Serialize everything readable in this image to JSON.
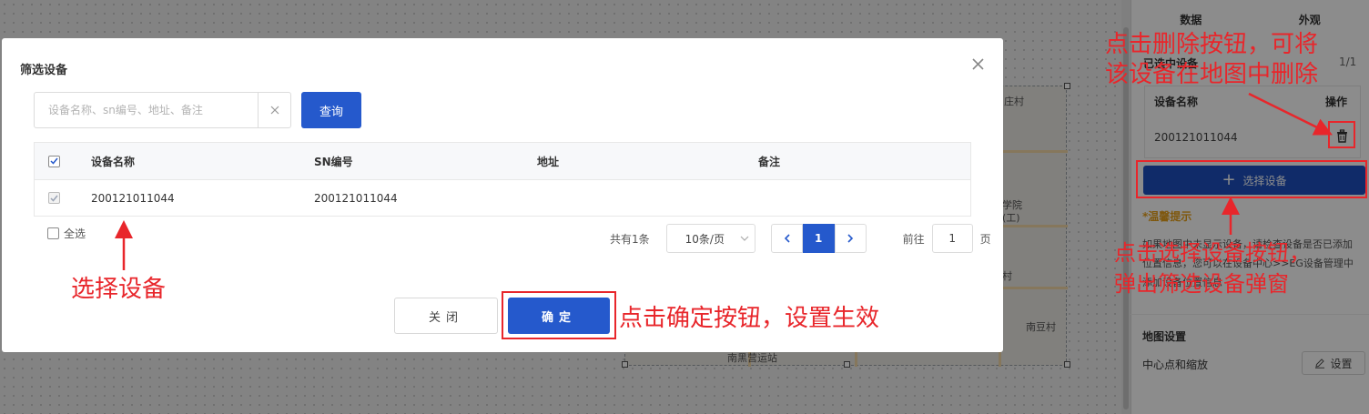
{
  "background_map": {
    "labels": [
      "庄村",
      "学院",
      "(工)",
      "南豆村",
      "南黑营运站",
      "村"
    ]
  },
  "right_panel": {
    "tabs": [
      "数据",
      "外观"
    ],
    "selected_title": "已选中设备",
    "selected_count": "1/1",
    "table_headers": {
      "name": "设备名称",
      "action": "操作"
    },
    "rows": [
      {
        "name": "200121011044"
      }
    ],
    "choose_device_label": "选择设备",
    "tip_title": "*温馨提示",
    "tip_text": "如果地图中未显示设备，请检查设备是否已添加位置信息，您可以在设备中心>>EG设备管理中添加设备位置信息",
    "map_settings_title": "地图设置",
    "center_zoom_label": "中心点和缩放",
    "settings_label": "设置"
  },
  "modal": {
    "title": "筛选设备",
    "search_placeholder": "设备名称、sn编号、地址、备注",
    "query_label": "查询",
    "columns": [
      "设备名称",
      "SN编号",
      "地址",
      "备注"
    ],
    "rows": [
      {
        "checked": true,
        "name": "200121011044",
        "sn": "200121011044",
        "address": "",
        "note": ""
      }
    ],
    "select_all_label": "全选",
    "pagination": {
      "total_text": "共有1条",
      "page_size": "10条/页",
      "current_page": "1",
      "goto_prefix": "前往",
      "goto_value": "1",
      "goto_suffix": "页"
    },
    "close_label": "关闭",
    "confirm_label": "确定"
  },
  "annotations": {
    "delete_tip": [
      "点击删除按钮，可将",
      "该设备在地图中删除"
    ],
    "choose_tip": [
      "点击选择设备按钮，",
      "弹出筛选设备弹窗"
    ],
    "select_tip": "选择设备",
    "confirm_tip": "点击确定按钮，设置生效"
  },
  "colors": {
    "primary": "#2559cc",
    "annotation": "#e8262b",
    "tip": "#e8a11b"
  }
}
